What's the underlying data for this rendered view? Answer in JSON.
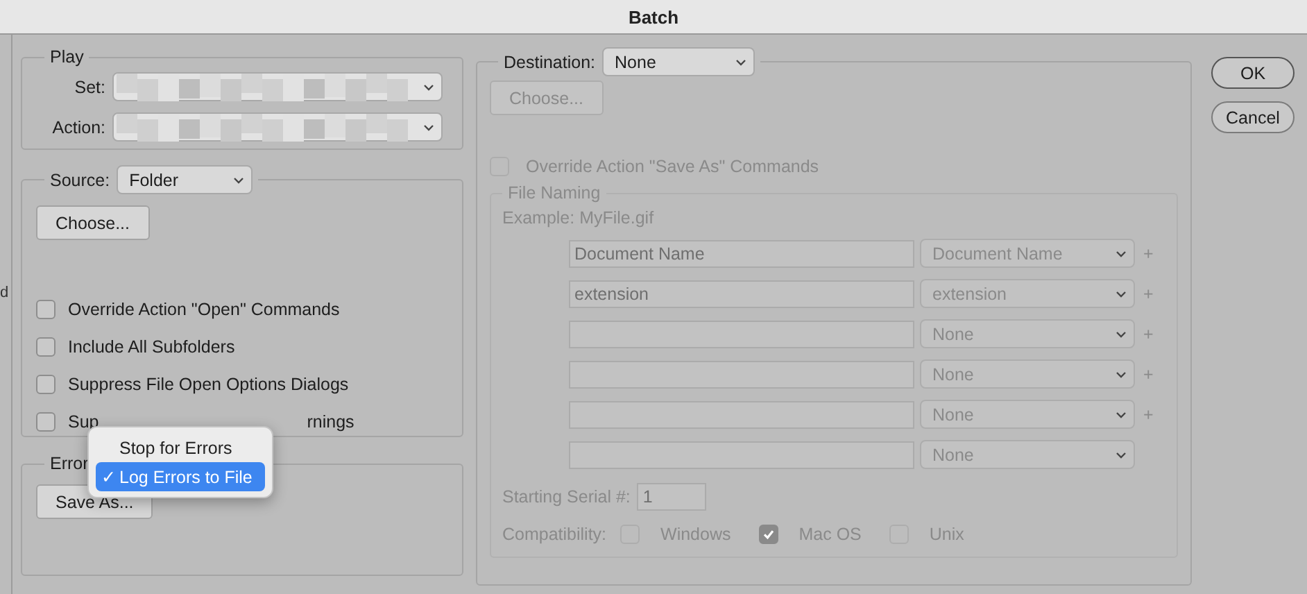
{
  "window": {
    "title": "Batch"
  },
  "background_text": "d",
  "play": {
    "title": "Play",
    "fields": [
      {
        "label": "Set:"
      },
      {
        "label": "Action:"
      }
    ]
  },
  "source": {
    "label": "Source:",
    "value": "Folder",
    "choose_button": "Choose...",
    "options": [
      {
        "kind": "full",
        "label": "Override Action \"Open\" Commands",
        "checked": false
      },
      {
        "kind": "full",
        "label": "Include All Subfolders",
        "checked": false
      },
      {
        "kind": "full",
        "label": "Suppress File Open Options Dialogs",
        "checked": false
      },
      {
        "kind": "partial",
        "label_start": "Sup",
        "label_end": "rnings",
        "checked": false
      }
    ]
  },
  "errors": {
    "label": "Error",
    "save_button": "Save As..."
  },
  "errors_menu": {
    "items": [
      {
        "label": "Stop for Errors",
        "selected": false
      },
      {
        "mark": "✓",
        "label": "Log Errors to File",
        "selected": true
      }
    ]
  },
  "destination": {
    "label": "Destination:",
    "value": "None",
    "disabled": true,
    "choose_button": "Choose...",
    "override": {
      "label": "Override Action \"Save As\" Commands",
      "checked": false
    },
    "file_naming": {
      "title": "File Naming",
      "example": "Example: MyFile.gif",
      "rows": [
        {
          "placeholder": "Document Name",
          "value": "Document Name",
          "add": "+"
        },
        {
          "placeholder": "extension",
          "value": "extension",
          "add": "+"
        },
        {
          "value": "None",
          "add": "+"
        },
        {
          "value": "None",
          "add": "+"
        },
        {
          "value": "None",
          "add": "+"
        },
        {
          "value": "None"
        }
      ],
      "serial": {
        "label": "Starting Serial #:",
        "value": "1"
      },
      "compatibility": {
        "label": "Compatibility:",
        "options": [
          {
            "label": "Windows",
            "checked": false
          },
          {
            "label": "Mac OS",
            "checked": true
          },
          {
            "label": "Unix",
            "checked": false
          }
        ]
      }
    }
  },
  "buttons": [
    {
      "label": "OK",
      "default": true
    },
    {
      "label": "Cancel",
      "default": false
    }
  ]
}
